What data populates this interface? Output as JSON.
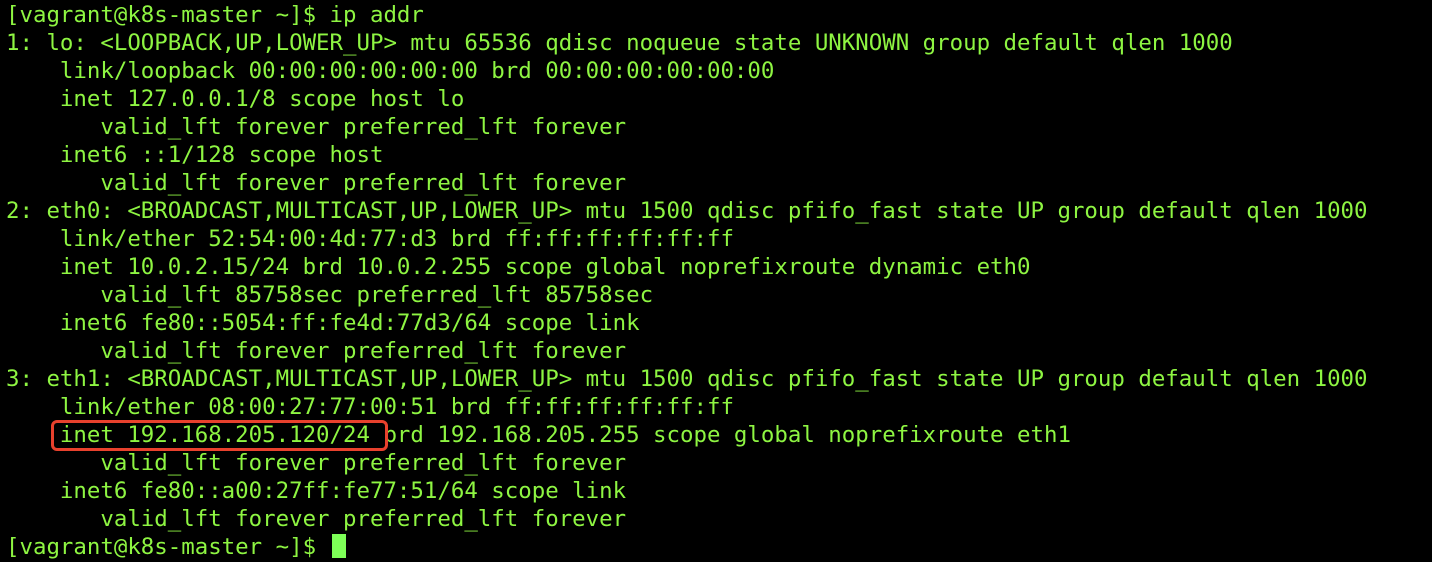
{
  "terminal": {
    "lines": [
      "[vagrant@k8s-master ~]$ ip addr",
      "1: lo: <LOOPBACK,UP,LOWER_UP> mtu 65536 qdisc noqueue state UNKNOWN group default qlen 1000",
      "    link/loopback 00:00:00:00:00:00 brd 00:00:00:00:00:00",
      "    inet 127.0.0.1/8 scope host lo",
      "       valid_lft forever preferred_lft forever",
      "    inet6 ::1/128 scope host",
      "       valid_lft forever preferred_lft forever",
      "2: eth0: <BROADCAST,MULTICAST,UP,LOWER_UP> mtu 1500 qdisc pfifo_fast state UP group default qlen 1000",
      "    link/ether 52:54:00:4d:77:d3 brd ff:ff:ff:ff:ff:ff",
      "    inet 10.0.2.15/24 brd 10.0.2.255 scope global noprefixroute dynamic eth0",
      "       valid_lft 85758sec preferred_lft 85758sec",
      "    inet6 fe80::5054:ff:fe4d:77d3/64 scope link",
      "       valid_lft forever preferred_lft forever",
      "3: eth1: <BROADCAST,MULTICAST,UP,LOWER_UP> mtu 1500 qdisc pfifo_fast state UP group default qlen 1000",
      "    link/ether 08:00:27:77:00:51 brd ff:ff:ff:ff:ff:ff",
      "    inet 192.168.205.120/24 brd 192.168.205.255 scope global noprefixroute eth1",
      "       valid_lft forever preferred_lft forever",
      "    inet6 fe80::a00:27ff:fe77:51/64 scope link",
      "       valid_lft forever preferred_lft forever",
      "[vagrant@k8s-master ~]$ "
    ],
    "highlighted_text": "inet 192.168.205.120/24"
  },
  "colors": {
    "background": "#000000",
    "text": "#8ef542",
    "highlight_border": "#e8412d",
    "cursor": "#7dff57"
  }
}
